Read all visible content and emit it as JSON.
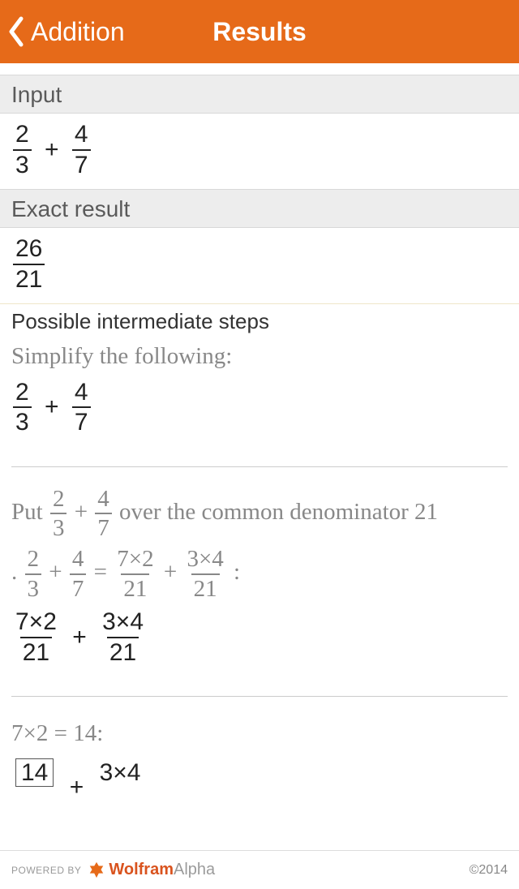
{
  "nav": {
    "back_label": "Addition",
    "title": "Results"
  },
  "sections": {
    "input_header": "Input",
    "exact_header": "Exact result",
    "steps_header": "Possible intermediate steps"
  },
  "input": {
    "f1_num": "2",
    "f1_den": "3",
    "plus": "+",
    "f2_num": "4",
    "f2_den": "7"
  },
  "exact": {
    "num": "26",
    "den": "21"
  },
  "step1": {
    "text": "Simplify the following:",
    "r_f1_num": "2",
    "r_f1_den": "3",
    "r_plus": "+",
    "r_f2_num": "4",
    "r_f2_den": "7"
  },
  "step2": {
    "t_pre": "Put ",
    "t_f1_num": "2",
    "t_f1_den": "3",
    "t_plus": " + ",
    "t_f2_num": "4",
    "t_f2_den": "7",
    "t_post": " over the common denominator 21",
    "t2_dot": ". ",
    "t2_f1_num": "2",
    "t2_f1_den": "3",
    "t2_plus": " + ",
    "t2_f2_num": "4",
    "t2_f2_den": "7",
    "t2_eq": " = ",
    "t2_f3_num": "7×2",
    "t2_f3_den": "21",
    "t2_plus2": " + ",
    "t2_f4_num": "3×4",
    "t2_f4_den": "21",
    "t2_colon": ":",
    "r_f1_num": "7×2",
    "r_f1_den": "21",
    "r_plus": "+",
    "r_f2_num": "3×4",
    "r_f2_den": "21"
  },
  "step3": {
    "text": "7×2 = 14:",
    "r_boxed": "14",
    "r_plus": "+",
    "r_f2_num": "3×4"
  },
  "footer": {
    "powered": "POWERED BY",
    "wa_bold": "Wolfram",
    "wa_light": "Alpha",
    "copyright": "©2014"
  }
}
